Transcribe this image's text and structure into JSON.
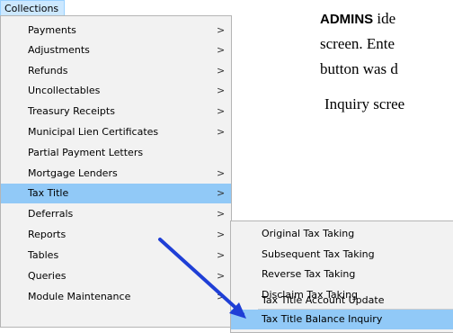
{
  "menubar": {
    "collections_label": "Collections"
  },
  "menu": {
    "items": [
      {
        "label": "Payments",
        "submenu": true
      },
      {
        "label": "Adjustments",
        "submenu": true
      },
      {
        "label": "Refunds",
        "submenu": true
      },
      {
        "label": "Uncollectables",
        "submenu": true
      },
      {
        "label": "Treasury Receipts",
        "submenu": true
      },
      {
        "label": "Municipal Lien Certificates",
        "submenu": true
      },
      {
        "label": "Partial Payment Letters",
        "submenu": false
      },
      {
        "label": "Mortgage Lenders",
        "submenu": true
      },
      {
        "label": "Tax Title",
        "submenu": true,
        "selected": true
      },
      {
        "label": "Deferrals",
        "submenu": true
      },
      {
        "label": "Reports",
        "submenu": true
      },
      {
        "label": "Tables",
        "submenu": true
      },
      {
        "label": "Queries",
        "submenu": true
      },
      {
        "label": "Module Maintenance",
        "submenu": true
      }
    ],
    "chevron": ">"
  },
  "submenu": {
    "items": [
      {
        "label": "Original Tax Taking"
      },
      {
        "label": "Subsequent Tax Taking"
      },
      {
        "label": "Reverse Tax Taking"
      },
      {
        "label": "Disclaim Tax Taking"
      },
      {
        "label": "Tax Title Account Update"
      },
      {
        "label": "Tax Title Balance Inquiry",
        "selected": true
      }
    ]
  },
  "doc": {
    "line1_bold": "ADMINS",
    "line1_rest": " ide",
    "line2": "screen.  Ente",
    "line3": "button was d",
    "line4": "Inquiry scree"
  },
  "colors": {
    "highlight": "#91c9f7",
    "arrow": "#1f3fd6",
    "menu_bg": "#f2f2f2"
  }
}
